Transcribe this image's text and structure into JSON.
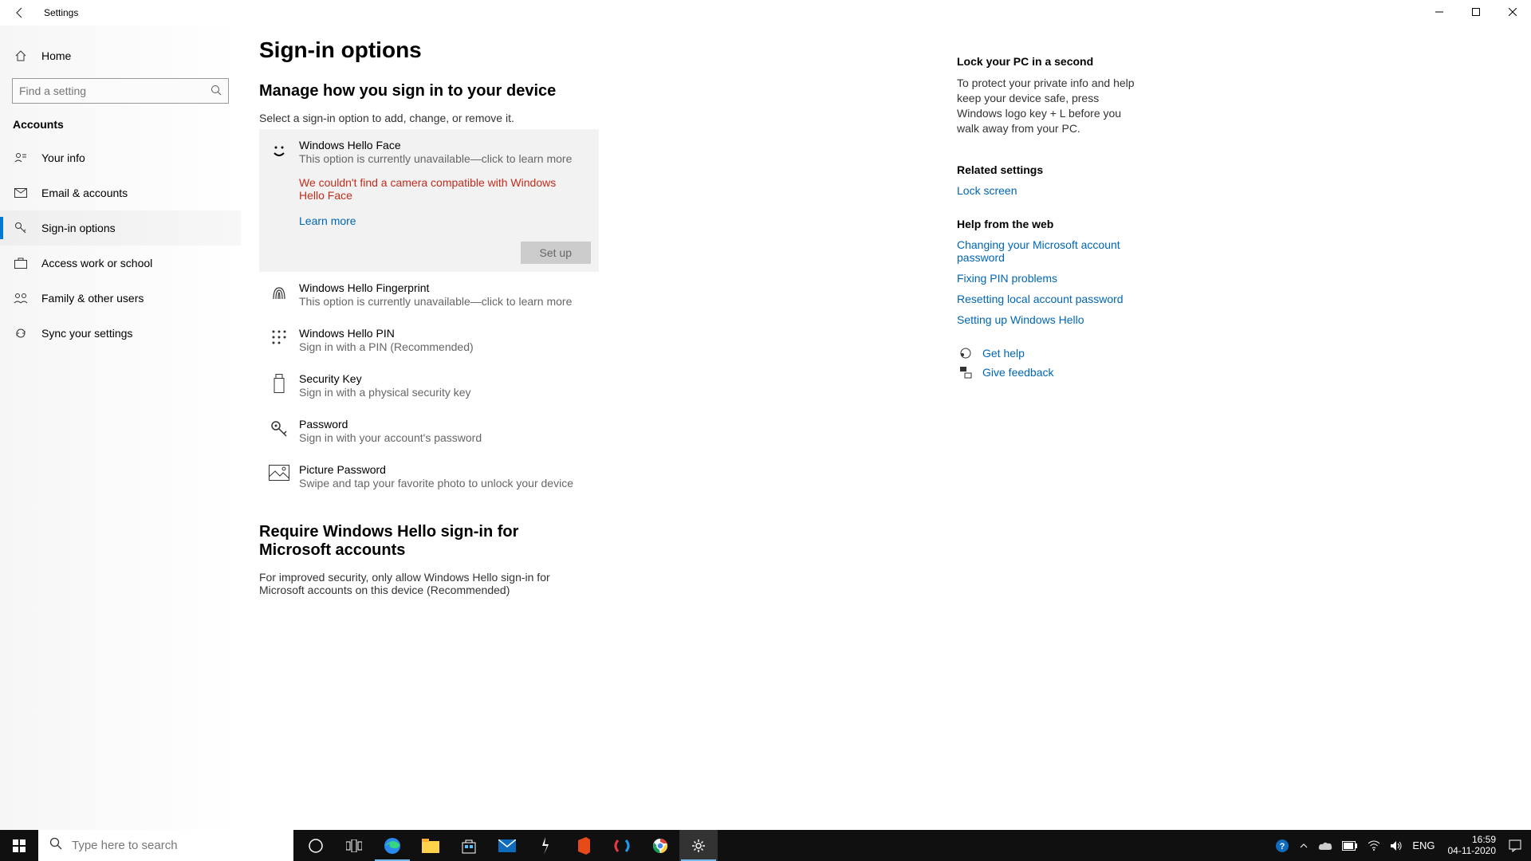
{
  "window": {
    "title": "Settings"
  },
  "sidebar": {
    "home": "Home",
    "search_placeholder": "Find a setting",
    "section": "Accounts",
    "items": [
      {
        "label": "Your info"
      },
      {
        "label": "Email & accounts"
      },
      {
        "label": "Sign-in options"
      },
      {
        "label": "Access work or school"
      },
      {
        "label": "Family & other users"
      },
      {
        "label": "Sync your settings"
      }
    ]
  },
  "main": {
    "title": "Sign-in options",
    "subtitle": "Manage how you sign in to your device",
    "instruction": "Select a sign-in option to add, change, or remove it.",
    "options": [
      {
        "title": "Windows Hello Face",
        "desc": "This option is currently unavailable—click to learn more",
        "error": "We couldn't find a camera compatible with Windows Hello Face",
        "learn_more": "Learn more",
        "setup": "Set up"
      },
      {
        "title": "Windows Hello Fingerprint",
        "desc": "This option is currently unavailable—click to learn more"
      },
      {
        "title": "Windows Hello PIN",
        "desc": "Sign in with a PIN (Recommended)"
      },
      {
        "title": "Security Key",
        "desc": "Sign in with a physical security key"
      },
      {
        "title": "Password",
        "desc": "Sign in with your account's password"
      },
      {
        "title": "Picture Password",
        "desc": "Swipe and tap your favorite photo to unlock your device"
      }
    ],
    "require_title": "Require Windows Hello sign-in for Microsoft accounts",
    "require_desc": "For improved security, only allow Windows Hello sign-in for Microsoft accounts on this device (Recommended)"
  },
  "rail": {
    "lock_title": "Lock your PC in a second",
    "lock_desc": "To protect your private info and help keep your device safe, press Windows logo key + L before you walk away from your PC.",
    "related_title": "Related settings",
    "lock_screen": "Lock screen",
    "help_title": "Help from the web",
    "help_links": [
      "Changing your Microsoft account password",
      "Fixing PIN problems",
      "Resetting local account password",
      "Setting up Windows Hello"
    ],
    "get_help": "Get help",
    "give_feedback": "Give feedback"
  },
  "taskbar": {
    "search_placeholder": "Type here to search",
    "lang": "ENG",
    "time": "16:59",
    "date": "04-11-2020"
  }
}
